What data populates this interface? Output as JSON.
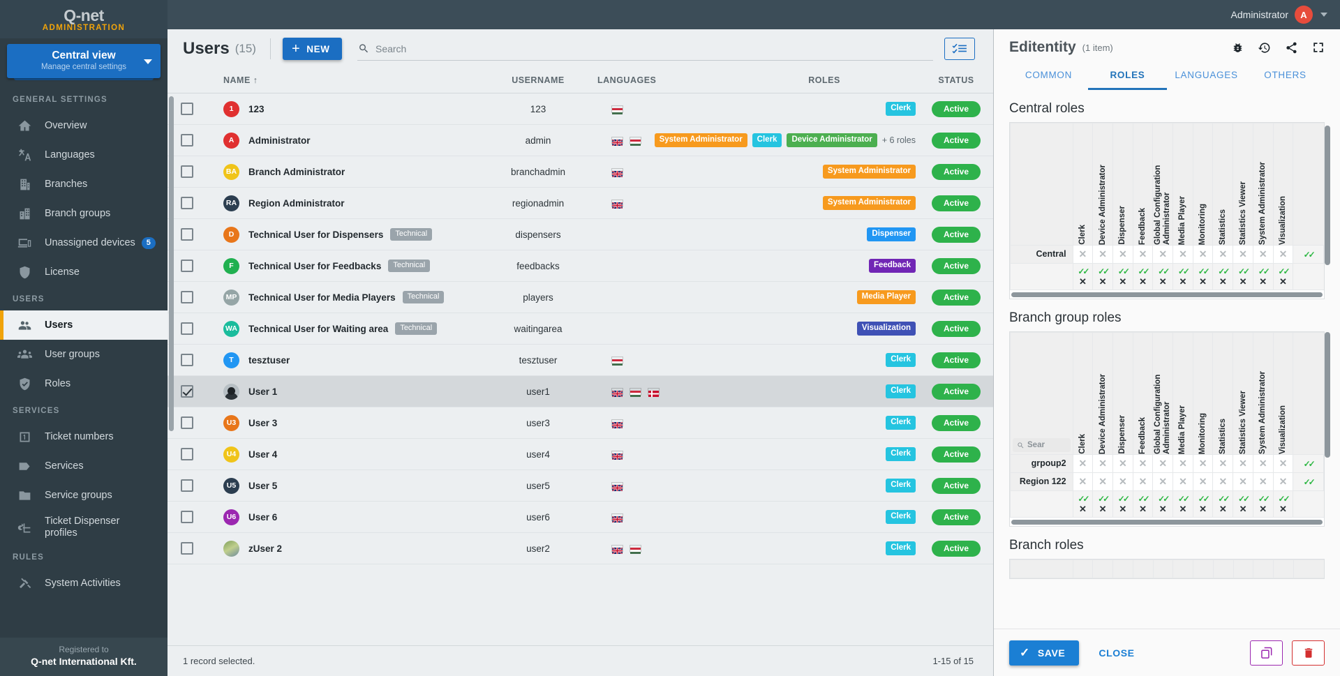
{
  "brand": {
    "logo": "Q-net",
    "sub": "ADMINISTRATION"
  },
  "topbar": {
    "user": "Administrator",
    "avatar_initial": "A"
  },
  "viewselector": {
    "title": "Central view",
    "subtitle": "Manage central settings"
  },
  "sidebar": {
    "sections": [
      {
        "label": "GENERAL SETTINGS",
        "items": [
          {
            "label": "Overview",
            "icon": "home-icon",
            "active": false
          },
          {
            "label": "Languages",
            "icon": "translate-icon",
            "active": false
          },
          {
            "label": "Branches",
            "icon": "building-icon",
            "active": false
          },
          {
            "label": "Branch groups",
            "icon": "buildings-icon",
            "active": false
          },
          {
            "label": "Unassigned devices",
            "icon": "devices-icon",
            "active": false,
            "badge": "5"
          },
          {
            "label": "License",
            "icon": "shield-icon",
            "active": false
          }
        ]
      },
      {
        "label": "USERS",
        "items": [
          {
            "label": "Users",
            "icon": "users-icon",
            "active": true
          },
          {
            "label": "User groups",
            "icon": "usergroups-icon",
            "active": false
          },
          {
            "label": "Roles",
            "icon": "shield-check-icon",
            "active": false
          }
        ]
      },
      {
        "label": "SERVICES",
        "items": [
          {
            "label": "Ticket numbers",
            "icon": "number-one-icon",
            "active": false
          },
          {
            "label": "Services",
            "icon": "tag-icon",
            "active": false
          },
          {
            "label": "Service groups",
            "icon": "folder-icon",
            "active": false
          },
          {
            "label": "Ticket Dispenser profiles",
            "icon": "dispenser-icon",
            "active": false
          }
        ]
      },
      {
        "label": "RULES",
        "items": [
          {
            "label": "System Activities",
            "icon": "gavel-icon",
            "active": false
          }
        ]
      }
    ],
    "footer": {
      "line1": "Registered to",
      "line2": "Q-net International Kft."
    }
  },
  "list": {
    "title": "Users",
    "count": "(15)",
    "new_label": "NEW",
    "search_placeholder": "Search",
    "search_value": "",
    "columns": [
      "NAME ↑",
      "USERNAME",
      "LANGUAGES",
      "ROLES",
      "STATUS"
    ],
    "footer_left": "1 record selected.",
    "footer_right": "1-15 of 15",
    "rows": [
      {
        "checked": false,
        "avatar": "1",
        "avatar_color": "#e03030",
        "name": "123",
        "tag": "",
        "username": "123",
        "languages": [
          "hu"
        ],
        "roles": [
          {
            "label": "Clerk",
            "color": "#25c4e0"
          }
        ],
        "more_roles": "",
        "status": "Active"
      },
      {
        "checked": false,
        "avatar": "A",
        "avatar_color": "#e03030",
        "name": "Administrator",
        "tag": "",
        "username": "admin",
        "languages": [
          "gb",
          "hu"
        ],
        "roles": [
          {
            "label": "System Administrator",
            "color": "#f79a1e"
          },
          {
            "label": "Clerk",
            "color": "#25c4e0"
          },
          {
            "label": "Device Administrator",
            "color": "#4caf50"
          }
        ],
        "more_roles": "+ 6 roles",
        "status": "Active"
      },
      {
        "checked": false,
        "avatar": "BA",
        "avatar_color": "#f0c419",
        "name": "Branch Administrator",
        "tag": "",
        "username": "branchadmin",
        "languages": [
          "gb"
        ],
        "roles": [
          {
            "label": "System Administrator",
            "color": "#f79a1e"
          }
        ],
        "more_roles": "",
        "status": "Active"
      },
      {
        "checked": false,
        "avatar": "RA",
        "avatar_color": "#2c3e50",
        "name": "Region Administrator",
        "tag": "",
        "username": "regionadmin",
        "languages": [
          "gb"
        ],
        "roles": [
          {
            "label": "System Administrator",
            "color": "#f79a1e"
          }
        ],
        "more_roles": "",
        "status": "Active"
      },
      {
        "checked": false,
        "avatar": "D",
        "avatar_color": "#e8761a",
        "name": "Technical User for Dispensers",
        "tag": "Technical",
        "username": "dispensers",
        "languages": [],
        "roles": [
          {
            "label": "Dispenser",
            "color": "#2196f3"
          }
        ],
        "more_roles": "",
        "status": "Active"
      },
      {
        "checked": false,
        "avatar": "F",
        "avatar_color": "#20b050",
        "name": "Technical User for Feedbacks",
        "tag": "Technical",
        "username": "feedbacks",
        "languages": [],
        "roles": [
          {
            "label": "Feedback",
            "color": "#7126b5"
          }
        ],
        "more_roles": "",
        "status": "Active"
      },
      {
        "checked": false,
        "avatar": "MP",
        "avatar_color": "#95a5a6",
        "name": "Technical User for Media Players",
        "tag": "Technical",
        "username": "players",
        "languages": [],
        "roles": [
          {
            "label": "Media Player",
            "color": "#f79a1e"
          }
        ],
        "more_roles": "",
        "status": "Active"
      },
      {
        "checked": false,
        "avatar": "WA",
        "avatar_color": "#1abc9c",
        "name": "Technical User for Waiting area",
        "tag": "Technical",
        "username": "waitingarea",
        "languages": [],
        "roles": [
          {
            "label": "Visualization",
            "color": "#3f51b5"
          }
        ],
        "more_roles": "",
        "status": "Active"
      },
      {
        "checked": false,
        "avatar": "T",
        "avatar_color": "#2196f3",
        "name": "tesztuser",
        "tag": "",
        "username": "tesztuser",
        "languages": [
          "hu"
        ],
        "roles": [
          {
            "label": "Clerk",
            "color": "#25c4e0"
          }
        ],
        "more_roles": "",
        "status": "Active"
      },
      {
        "checked": true,
        "avatar": "",
        "avatar_color": "photo",
        "name": "User 1",
        "tag": "",
        "username": "user1",
        "languages": [
          "gb",
          "hu",
          "dk"
        ],
        "roles": [
          {
            "label": "Clerk",
            "color": "#25c4e0"
          }
        ],
        "more_roles": "",
        "status": "Active"
      },
      {
        "checked": false,
        "avatar": "U3",
        "avatar_color": "#e8761a",
        "name": "User 3",
        "tag": "",
        "username": "user3",
        "languages": [
          "gb"
        ],
        "roles": [
          {
            "label": "Clerk",
            "color": "#25c4e0"
          }
        ],
        "more_roles": "",
        "status": "Active"
      },
      {
        "checked": false,
        "avatar": "U4",
        "avatar_color": "#f0c419",
        "name": "User 4",
        "tag": "",
        "username": "user4",
        "languages": [
          "gb"
        ],
        "roles": [
          {
            "label": "Clerk",
            "color": "#25c4e0"
          }
        ],
        "more_roles": "",
        "status": "Active"
      },
      {
        "checked": false,
        "avatar": "U5",
        "avatar_color": "#2c3e50",
        "name": "User 5",
        "tag": "",
        "username": "user5",
        "languages": [
          "gb"
        ],
        "roles": [
          {
            "label": "Clerk",
            "color": "#25c4e0"
          }
        ],
        "more_roles": "",
        "status": "Active"
      },
      {
        "checked": false,
        "avatar": "U6",
        "avatar_color": "#9b27b0",
        "name": "User 6",
        "tag": "",
        "username": "user6",
        "languages": [
          "gb"
        ],
        "roles": [
          {
            "label": "Clerk",
            "color": "#25c4e0"
          }
        ],
        "more_roles": "",
        "status": "Active"
      },
      {
        "checked": false,
        "avatar": "",
        "avatar_color": "photo2",
        "name": "zUser 2",
        "tag": "",
        "username": "user2",
        "languages": [
          "gb",
          "hu"
        ],
        "roles": [
          {
            "label": "Clerk",
            "color": "#25c4e0"
          }
        ],
        "more_roles": "",
        "status": "Active"
      }
    ]
  },
  "editpanel": {
    "title": "Editentity",
    "count": "(1 item)",
    "icons": [
      "bug-icon",
      "history-icon",
      "share-icon",
      "fullscreen-icon"
    ],
    "tabs": [
      {
        "label": "COMMON",
        "active": false
      },
      {
        "label": "ROLES",
        "active": true
      },
      {
        "label": "LANGUAGES",
        "active": false
      },
      {
        "label": "OTHERS",
        "active": false
      }
    ],
    "role_columns": [
      "Clerk",
      "Device Administrator",
      "Dispenser",
      "Feedback",
      "Global Configuration Administrator",
      "Media Player",
      "Monitoring",
      "Statistics",
      "Statistics Viewer",
      "System Administrator",
      "Visualization"
    ],
    "sections": [
      {
        "title": "Central roles",
        "search_placeholder": "",
        "rows": [
          {
            "label": "Central",
            "cells": [
              "x",
              "x",
              "x",
              "x",
              "x",
              "x",
              "x",
              "x",
              "x",
              "x",
              "x"
            ],
            "last": "check"
          }
        ],
        "bulk_row": {
          "top": [
            "check",
            "check",
            "check",
            "check",
            "check",
            "check",
            "check",
            "check",
            "check",
            "check",
            "check"
          ],
          "bottom": [
            "x",
            "x",
            "x",
            "x",
            "x",
            "x",
            "x",
            "x",
            "x",
            "x",
            "x"
          ]
        }
      },
      {
        "title": "Branch group roles",
        "search_placeholder": "Sear",
        "rows": [
          {
            "label": "grpoup2",
            "cells": [
              "x",
              "x",
              "x",
              "x",
              "x",
              "x",
              "x",
              "x",
              "x",
              "x",
              "x"
            ],
            "last": "check"
          },
          {
            "label": "Region 122",
            "cells": [
              "x",
              "x",
              "x",
              "x",
              "x",
              "x",
              "x",
              "x",
              "x",
              "x",
              "x"
            ],
            "last": "check"
          }
        ],
        "bulk_row": {
          "top": [
            "check",
            "check",
            "check",
            "check",
            "check",
            "check",
            "check",
            "check",
            "check",
            "check",
            "check"
          ],
          "bottom": [
            "x",
            "x",
            "x",
            "x",
            "x",
            "x",
            "x",
            "x",
            "x",
            "x",
            "x"
          ]
        }
      },
      {
        "title": "Branch roles",
        "search_placeholder": "",
        "rows": [],
        "bulk_row": null
      }
    ],
    "footer": {
      "save_label": "SAVE",
      "close_label": "CLOSE",
      "copy_icon": "copy-icon",
      "delete_icon": "trash-icon"
    }
  },
  "colors": {
    "accent_blue": "#1b6ec2",
    "accent_orange": "#f0a30a",
    "sidebar_bg": "#2f3d45",
    "status_green": "#2eb24b"
  }
}
